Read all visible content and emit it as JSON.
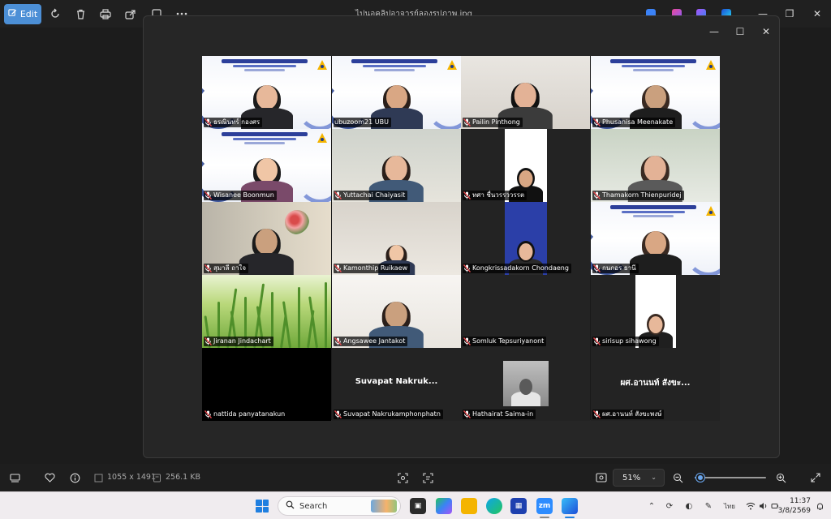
{
  "toolbar": {
    "edit_label": "Edit",
    "file_title": "ไปนอคลิปอาจารย์ลองรูปภาพ.jpg"
  },
  "icons": {
    "edit": "edit-icon",
    "rotate": "rotate-icon",
    "delete": "trash-icon",
    "print": "print-icon",
    "share": "share-icon",
    "more": "more-icon"
  },
  "participants": [
    {
      "name": "ธรณินทร์ กองศร",
      "muted": true,
      "bg": "banner"
    },
    {
      "name": "ubuzoom21 UBU",
      "muted": false,
      "bg": "banner",
      "active": true
    },
    {
      "name": "Pailin Pinthong",
      "muted": true,
      "bg": "room"
    },
    {
      "name": "Phusanisa Meenakate",
      "muted": true,
      "bg": "banner"
    },
    {
      "name": "Wisanee Boonmun",
      "muted": true,
      "bg": "banner"
    },
    {
      "name": "Yuttachai Chaiyasit",
      "muted": true,
      "bg": "room"
    },
    {
      "name": "ทศา ชื่นวรรววรรต",
      "muted": true,
      "bg": "portrait"
    },
    {
      "name": "Thamakorn Thienpuridej",
      "muted": true,
      "bg": "room"
    },
    {
      "name": "สุมาลี ถาใจ",
      "muted": true,
      "bg": "room"
    },
    {
      "name": "Kamonthip Ruikaew",
      "muted": true,
      "bg": "room"
    },
    {
      "name": "Kongkrissadakorn Chondaeng",
      "muted": true,
      "bg": "portrait"
    },
    {
      "name": "กนกอร ธานี",
      "muted": true,
      "bg": "banner"
    },
    {
      "name": "Jiranan Jindachart",
      "muted": true,
      "bg": "grass"
    },
    {
      "name": "Angsawee Jantakot",
      "muted": true,
      "bg": "room"
    },
    {
      "name": "Somluk Tepsuriyanont",
      "muted": true,
      "bg": "dark"
    },
    {
      "name": "sirisup sihawong",
      "muted": true,
      "bg": "portrait"
    },
    {
      "name": "nattida panyatanakun",
      "muted": true,
      "bg": "black"
    },
    {
      "name": "Suvapat Nakrukamphonphatn",
      "muted": true,
      "bg": "dark",
      "center_text": "Suvapat  Nakruk..."
    },
    {
      "name": "Hathairat Saima-in",
      "muted": true,
      "bg": "avatar"
    },
    {
      "name": "ผศ.อานนท์ สังขะพงษ์",
      "muted": true,
      "bg": "dark",
      "center_text": "ผศ.อานนท์ สังขะ..."
    }
  ],
  "info": {
    "dimensions": "1055 x 1491",
    "filesize": "256.1 KB",
    "zoom": "51%",
    "zoom_level_fraction": 0.08
  },
  "taskbar": {
    "search_placeholder": "Search",
    "language": "ไทย",
    "time": "11:37",
    "date": "3/8/2569"
  }
}
